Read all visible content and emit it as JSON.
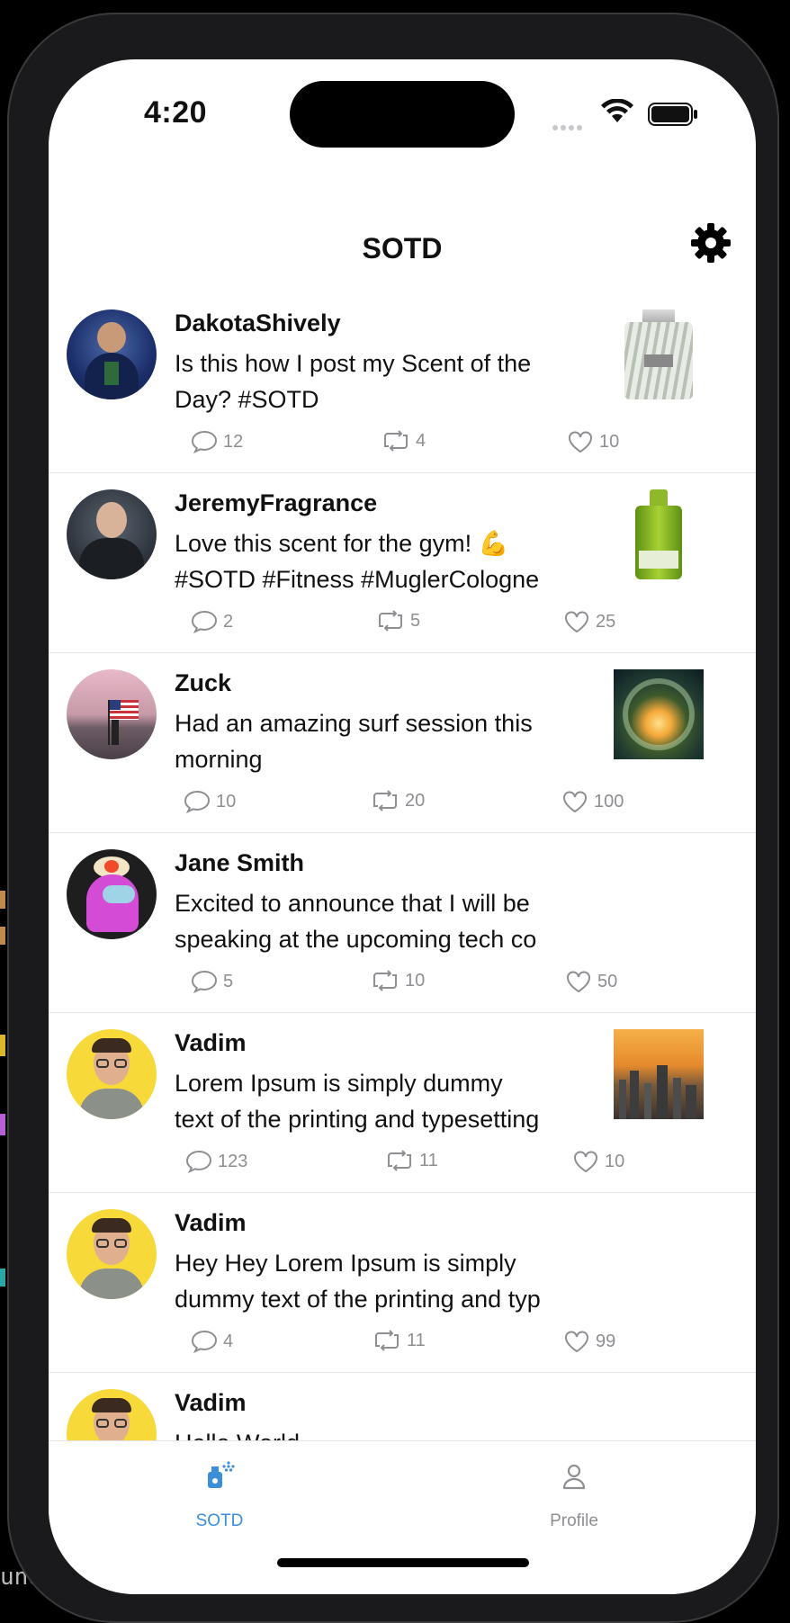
{
  "status": {
    "time": "4:20"
  },
  "nav": {
    "title": "SOTD"
  },
  "posts": [
    {
      "user": "DakotaShively",
      "text": "Is this how I post my Scent of the\nDay? #SOTD",
      "comments": "12",
      "reposts": "4",
      "likes": "10"
    },
    {
      "user": "JeremyFragrance",
      "text": "Love this scent for the gym! 💪\n#SOTD #Fitness #MuglerCologne",
      "comments": "2",
      "reposts": "5",
      "likes": "25"
    },
    {
      "user": "Zuck",
      "text": "Had an amazing surf session this\nmorning",
      "comments": "10",
      "reposts": "20",
      "likes": "100"
    },
    {
      "user": "Jane Smith",
      "text": "Excited to announce that I will be\nspeaking at the upcoming tech co",
      "comments": "5",
      "reposts": "10",
      "likes": "50"
    },
    {
      "user": "Vadim",
      "text": "Lorem Ipsum is simply dummy\ntext of the printing and typesetting",
      "comments": "123",
      "reposts": "11",
      "likes": "10"
    },
    {
      "user": "Vadim",
      "text": "Hey Hey Lorem Ipsum is simply\ndummy text of the printing and typ",
      "comments": "4",
      "reposts": "11",
      "likes": "99"
    },
    {
      "user": "Vadim",
      "text": "Hello World"
    }
  ],
  "tabs": [
    {
      "label": "SOTD",
      "icon": "perfume-bottle-icon",
      "active": true
    },
    {
      "label": "Profile",
      "icon": "person-icon",
      "active": false
    }
  ],
  "background_peek": {
    "text": "und :"
  },
  "colors": {
    "accent": "#3a8fd8",
    "inactive": "#8e8e93",
    "muted_text": "#8e8e93"
  }
}
